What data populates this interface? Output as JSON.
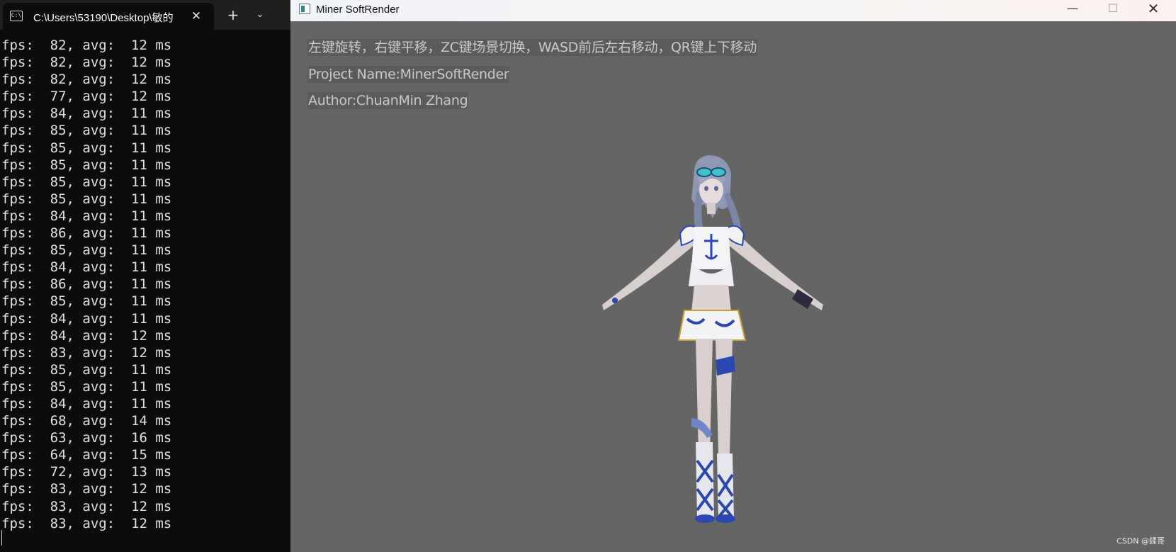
{
  "terminal": {
    "tab_title": "C:\\Users\\53190\\Desktop\\敏的",
    "tab_icon": "terminal-icon",
    "close_glyph": "✕",
    "new_tab_glyph": "+",
    "dropdown_glyph": "⌄",
    "lines": [
      "fps:  82, avg:  12 ms",
      "fps:  82, avg:  12 ms",
      "fps:  82, avg:  12 ms",
      "fps:  77, avg:  12 ms",
      "fps:  84, avg:  11 ms",
      "fps:  85, avg:  11 ms",
      "fps:  85, avg:  11 ms",
      "fps:  85, avg:  11 ms",
      "fps:  85, avg:  11 ms",
      "fps:  85, avg:  11 ms",
      "fps:  84, avg:  11 ms",
      "fps:  86, avg:  11 ms",
      "fps:  85, avg:  11 ms",
      "fps:  84, avg:  11 ms",
      "fps:  86, avg:  11 ms",
      "fps:  85, avg:  11 ms",
      "fps:  84, avg:  11 ms",
      "fps:  84, avg:  12 ms",
      "fps:  83, avg:  12 ms",
      "fps:  85, avg:  11 ms",
      "fps:  85, avg:  11 ms",
      "fps:  84, avg:  11 ms",
      "fps:  68, avg:  14 ms",
      "fps:  63, avg:  16 ms",
      "fps:  64, avg:  15 ms",
      "fps:  72, avg:  13 ms",
      "fps:  83, avg:  12 ms",
      "fps:  83, avg:  12 ms",
      "fps:  83, avg:  12 ms"
    ]
  },
  "render_window": {
    "title": "Miner SoftRender",
    "minimize_glyph": "—",
    "maximize_glyph": "☐",
    "close_glyph": "✕",
    "info_lines": [
      "左键旋转，右键平移，ZC键场景切换，WASD前后左右移动，QR键上下移动",
      "Project Name:MinerSoftRender",
      "Author:ChuanMin Zhang"
    ],
    "watermark": "CSDN @鍒哥"
  },
  "colors": {
    "terminal_bg": "#0c0c0c",
    "terminal_tabbar": "#1f1f1f",
    "terminal_text": "#e0e0e0",
    "viewport_bg": "#656565",
    "info_text": "#c9c9c9",
    "info_bg": "#5b5b5b",
    "outfit_blue": "#2a48b0"
  }
}
